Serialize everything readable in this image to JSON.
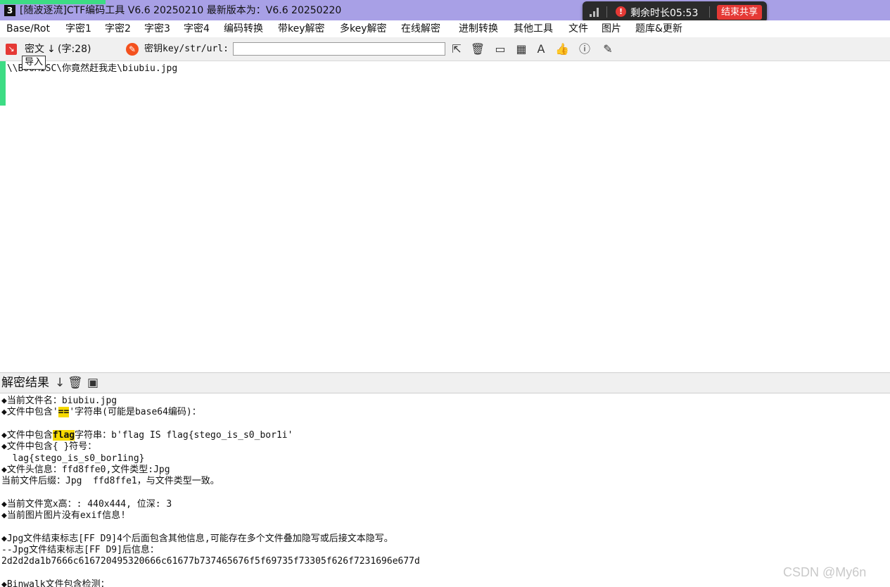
{
  "title_bar": {
    "app_icon": "3",
    "title": "[随波逐流]CTF编码工具 V6.6 20250210    最新版本为：V6.6 20250220"
  },
  "share_pill": {
    "warn_glyph": "!",
    "remaining_time": "剩余时长05:53",
    "end_share_label": "结束共享"
  },
  "menu": {
    "items": [
      "Base/Rot",
      "字密1",
      "字密2",
      "字密3",
      "字密4",
      "编码转换",
      "带key解密",
      "多key解密",
      "在线解密",
      "进制转换",
      "其他工具",
      "文件",
      "图片",
      "题库&更新"
    ]
  },
  "toolbar": {
    "cipher_label": "密文",
    "cipher_count": "(字:28)",
    "key_label": "密钥key/str/url:",
    "key_value": "",
    "tooltip": "导入",
    "tool_icons": [
      "cursor-icon",
      "trash-icon",
      "terminal-icon",
      "calculator-icon",
      "font-icon",
      "thumbs-up-icon",
      "help-icon",
      "edit-icon"
    ]
  },
  "cipher": {
    "path": ":\\\\BooMISC\\你竟然赶我走\\biubiu.jpg"
  },
  "result": {
    "label": "解密结果",
    "lines": [
      {
        "pre": "◆当前文件名：biubiu.jpg",
        "hl": "",
        "post": ""
      },
      {
        "pre": "◆文件中包含'",
        "hl": "==",
        "post": "'字符串(可能是base64编码)："
      },
      {
        "pre": "",
        "hl": "",
        "post": ""
      },
      {
        "pre": "◆文件中包含",
        "hl": "flag",
        "post": "字符串：b'flag IS flag{stego_is_s0_bor1i'"
      },
      {
        "pre": "◆文件中包含{ }符号：",
        "hl": "",
        "post": ""
      },
      {
        "pre": "  lag{stego_is_s0_bor1ing}",
        "hl": "",
        "post": ""
      },
      {
        "pre": "◆文件头信息：ffd8ffe0,文件类型:Jpg",
        "hl": "",
        "post": ""
      },
      {
        "pre": "当前文件后缀：Jpg  ffd8ffe1，与文件类型一致。",
        "hl": "",
        "post": ""
      },
      {
        "pre": "",
        "hl": "",
        "post": ""
      },
      {
        "pre": "◆当前文件宽x高：: 440x444, 位深: 3",
        "hl": "",
        "post": ""
      },
      {
        "pre": "◆当前图片图片没有exif信息!",
        "hl": "",
        "post": ""
      },
      {
        "pre": "",
        "hl": "",
        "post": ""
      },
      {
        "pre": "◆Jpg文件结束标志[FF D9]4个后面包含其他信息,可能存在多个文件叠加隐写或后接文本隐写。",
        "hl": "",
        "post": ""
      },
      {
        "pre": "--Jpg文件结束标志[FF D9]后信息：",
        "hl": "",
        "post": ""
      },
      {
        "pre": "2d2d2da1b7666c616720495320666c61677b737465676f5f69735f73305f626f7231696e677d",
        "hl": "",
        "post": ""
      },
      {
        "pre": "",
        "hl": "",
        "post": ""
      },
      {
        "pre": "◆Binwalk文件包含检测：",
        "hl": "",
        "post": ""
      }
    ]
  },
  "watermark": "CSDN @My6n",
  "colors": {
    "title_bar": "#a8a0e6",
    "accent_green": "#3ddc84",
    "highlight": "#f5d800",
    "end_button": "#e53935"
  }
}
